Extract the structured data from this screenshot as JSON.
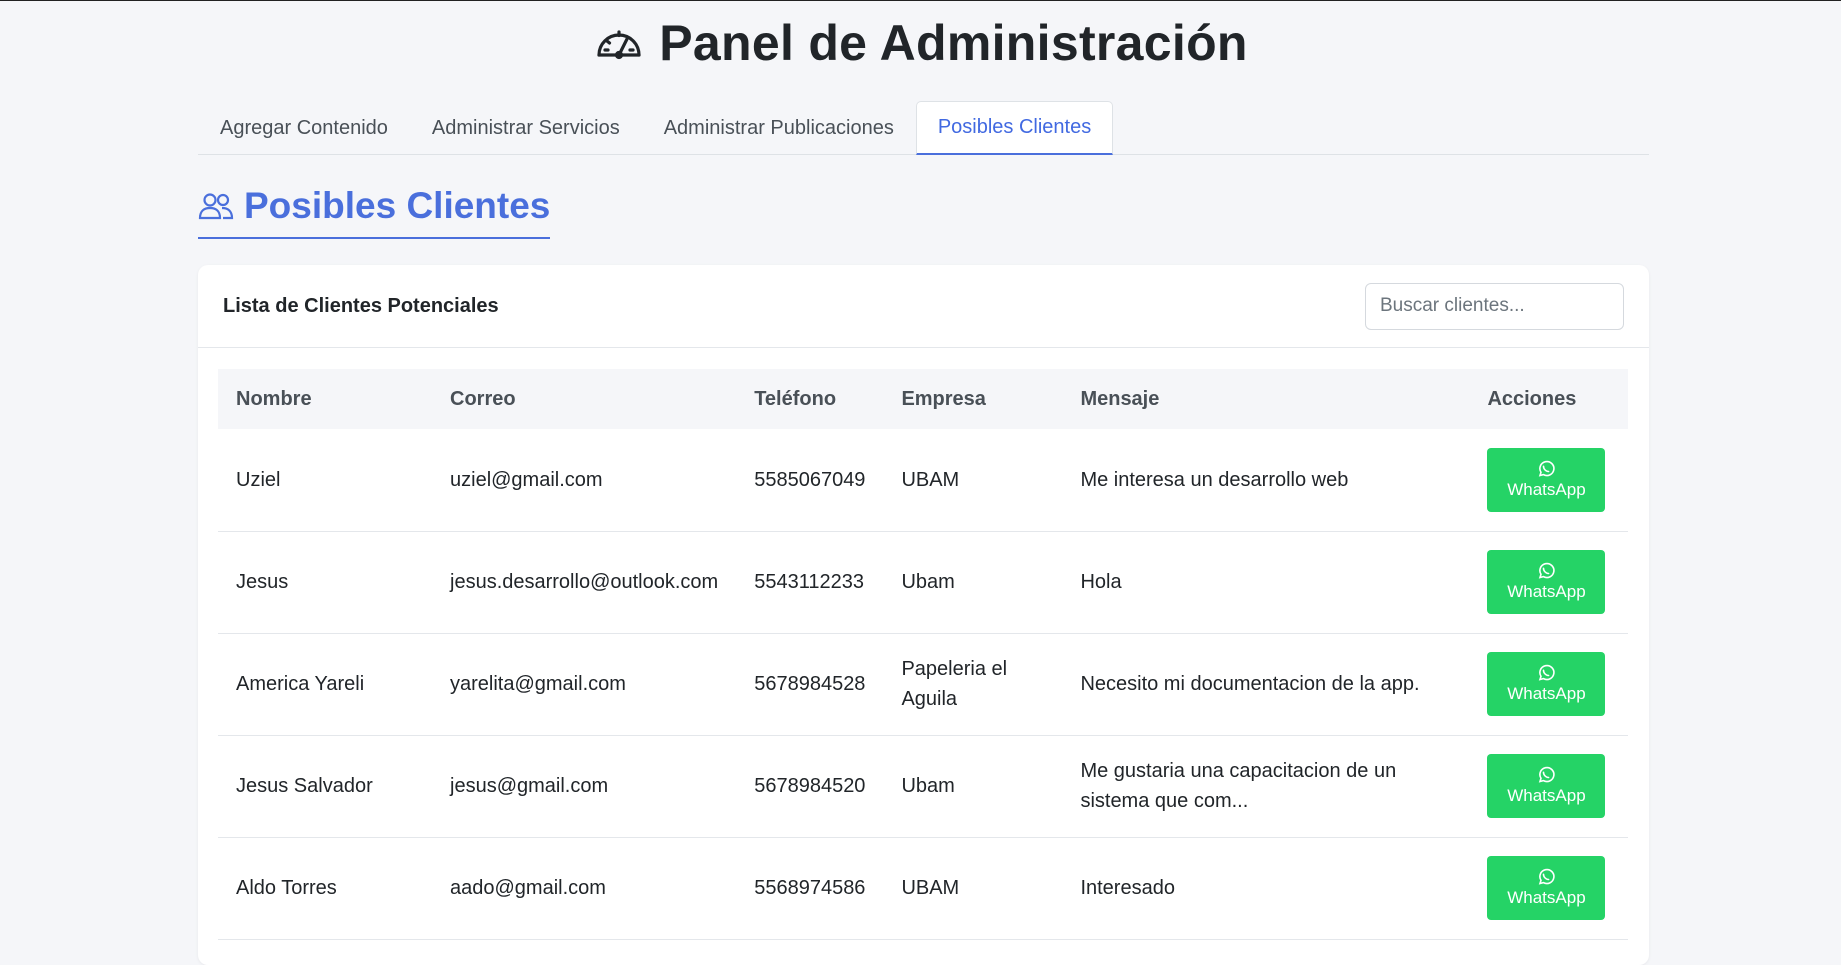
{
  "header": {
    "title": "Panel de Administración",
    "icon": "speedometer-icon"
  },
  "tabs": [
    {
      "label": "Agregar Contenido",
      "active": false
    },
    {
      "label": "Administrar Servicios",
      "active": false
    },
    {
      "label": "Administrar Publicaciones",
      "active": false
    },
    {
      "label": "Posibles Clientes",
      "active": true
    }
  ],
  "section": {
    "title": "Posibles Clientes",
    "icon": "people-icon"
  },
  "card": {
    "title": "Lista de Clientes Potenciales",
    "search_placeholder": "Buscar clientes...",
    "search_value": ""
  },
  "table": {
    "columns": [
      "Nombre",
      "Correo",
      "Teléfono",
      "Empresa",
      "Mensaje",
      "Acciones"
    ],
    "rows": [
      {
        "nombre": "Uziel",
        "correo": "uziel@gmail.com",
        "telefono": "5585067049",
        "empresa": "UBAM",
        "mensaje": "Me interesa un desarrollo web",
        "action": "WhatsApp"
      },
      {
        "nombre": "Jesus",
        "correo": "jesus.desarrollo@outlook.com",
        "telefono": "5543112233",
        "empresa": "Ubam",
        "mensaje": "Hola",
        "action": "WhatsApp"
      },
      {
        "nombre": "America Yareli",
        "correo": "yarelita@gmail.com",
        "telefono": "5678984528",
        "empresa": "Papeleria el Aguila",
        "mensaje": "Necesito mi documentacion de la app.",
        "action": "WhatsApp"
      },
      {
        "nombre": "Jesus Salvador",
        "correo": "jesus@gmail.com",
        "telefono": "5678984520",
        "empresa": "Ubam",
        "mensaje": "Me gustaria una capacitacion de un sistema que com...",
        "action": "WhatsApp"
      },
      {
        "nombre": "Aldo Torres",
        "correo": "aado@gmail.com",
        "telefono": "5568974586",
        "empresa": "UBAM",
        "mensaje": "Interesado",
        "action": "WhatsApp"
      }
    ]
  },
  "colors": {
    "accent": "#4a6fdc",
    "whatsapp": "#25d366",
    "background": "#f5f6f9"
  }
}
